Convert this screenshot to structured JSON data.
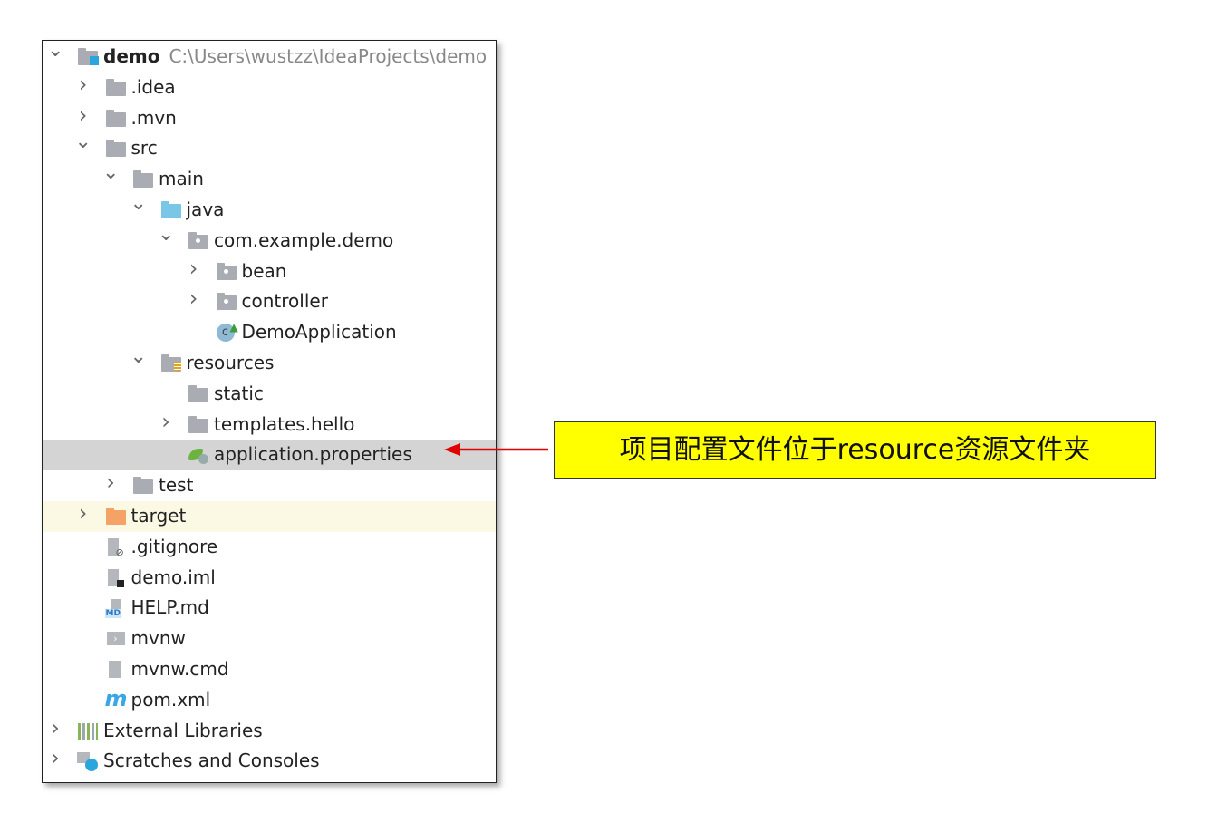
{
  "tree": [
    {
      "label": "demo",
      "path": "C:\\Users\\wustzz\\IdeaProjects\\demo",
      "level": 0,
      "chevron": "open",
      "icon": "module-folder-icon"
    },
    {
      "label": ".idea",
      "level": 1,
      "chevron": "closed",
      "icon": "folder-icon"
    },
    {
      "label": ".mvn",
      "level": 1,
      "chevron": "closed",
      "icon": "folder-icon"
    },
    {
      "label": "src",
      "level": 1,
      "chevron": "open",
      "icon": "folder-icon"
    },
    {
      "label": "main",
      "level": 2,
      "chevron": "open",
      "icon": "folder-icon"
    },
    {
      "label": "java",
      "level": 3,
      "chevron": "open",
      "icon": "source-folder-icon"
    },
    {
      "label": "com.example.demo",
      "level": 4,
      "chevron": "open",
      "icon": "package-icon"
    },
    {
      "label": "bean",
      "level": 5,
      "chevron": "closed",
      "icon": "package-icon"
    },
    {
      "label": "controller",
      "level": 5,
      "chevron": "closed",
      "icon": "package-icon"
    },
    {
      "label": "DemoApplication",
      "level": 5,
      "chevron": "none",
      "icon": "spring-class-icon"
    },
    {
      "label": "resources",
      "level": 3,
      "chevron": "open",
      "icon": "resources-folder-icon"
    },
    {
      "label": "static",
      "level": 4,
      "chevron": "none",
      "icon": "folder-icon"
    },
    {
      "label": "templates.hello",
      "level": 4,
      "chevron": "closed",
      "icon": "folder-icon"
    },
    {
      "label": "application.properties",
      "level": 4,
      "chevron": "none",
      "icon": "spring-properties-icon",
      "selected": true
    },
    {
      "label": "test",
      "level": 2,
      "chevron": "closed",
      "icon": "folder-icon"
    },
    {
      "label": "target",
      "level": 1,
      "chevron": "closed",
      "icon": "excluded-folder-icon",
      "highlighted": true
    },
    {
      "label": ".gitignore",
      "level": 1,
      "chevron": "none",
      "icon": "ignored-file-icon"
    },
    {
      "label": "demo.iml",
      "level": 1,
      "chevron": "none",
      "icon": "iml-file-icon"
    },
    {
      "label": "HELP.md",
      "level": 1,
      "chevron": "none",
      "icon": "markdown-file-icon"
    },
    {
      "label": "mvnw",
      "level": 1,
      "chevron": "none",
      "icon": "shell-file-icon"
    },
    {
      "label": "mvnw.cmd",
      "level": 1,
      "chevron": "none",
      "icon": "text-file-icon"
    },
    {
      "label": "pom.xml",
      "level": 1,
      "chevron": "none",
      "icon": "maven-icon"
    },
    {
      "label": "External Libraries",
      "level": 0,
      "chevron": "closed",
      "icon": "libraries-icon"
    },
    {
      "label": "Scratches and Consoles",
      "level": 0,
      "chevron": "closed",
      "icon": "scratches-icon"
    }
  ],
  "annotation": {
    "text": "项目配置文件位于resource资源文件夹",
    "background": "#ffff00",
    "arrow_color": "#e00000"
  }
}
